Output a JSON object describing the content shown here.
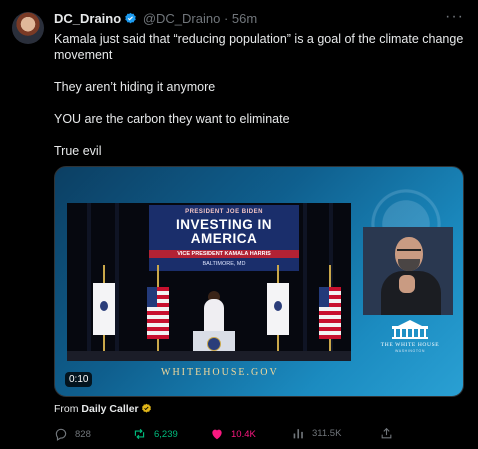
{
  "author": {
    "name": "DC_Draino",
    "handle": "@DC_Draino",
    "separator": "·",
    "timestamp": "56m",
    "verified": true
  },
  "more_icon": "more-horizontal-icon",
  "tweet": {
    "paragraphs": [
      "Kamala just said that “reducing population” is a goal of the climate change movement",
      "They aren’t hiding it anymore",
      "YOU are the carbon they want to eliminate",
      "True evil"
    ]
  },
  "media": {
    "type": "video",
    "duration": "0:10",
    "banner": {
      "line1": "PRESIDENT JOE BIDEN",
      "line2": "INVESTING IN",
      "line3": "AMERICA",
      "line4": "VICE PRESIDENT KAMALA HARRIS",
      "line5": "BALTIMORE, MD"
    },
    "domain_text": "WHITEHOUSE.GOV",
    "logo_text": "THE WHITE HOUSE",
    "logo_subtext": "WASHINGTON"
  },
  "source": {
    "label": "From",
    "name": "Daily Caller",
    "verified_gold": true
  },
  "actions": {
    "replies": "828",
    "reposts": "6,239",
    "likes": "10.4K",
    "views": "311.5K"
  },
  "colors": {
    "background": "#000000",
    "text": "#e7e9ea",
    "muted": "#71767b",
    "verified_blue": "#1d9bf0",
    "verified_gold": "#e2b719",
    "repost_active": "#00ba7c",
    "like_active": "#f91880"
  }
}
